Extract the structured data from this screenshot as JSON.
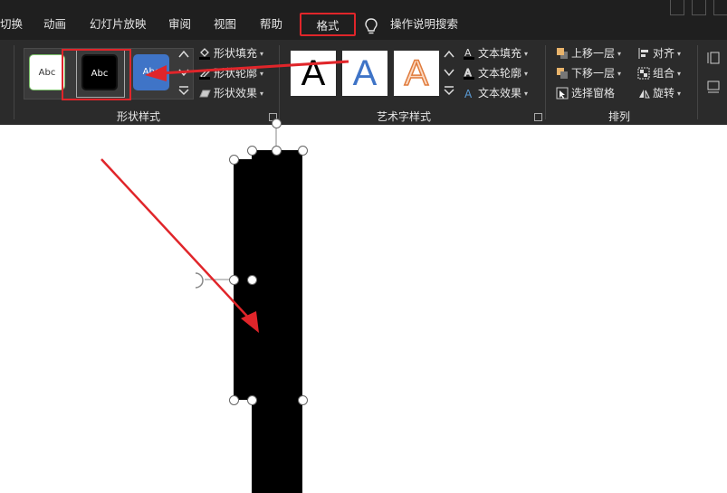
{
  "tabs": [
    {
      "label": "切换"
    },
    {
      "label": "动画"
    },
    {
      "label": "幻灯片放映"
    },
    {
      "label": "审阅"
    },
    {
      "label": "视图"
    },
    {
      "label": "帮助"
    },
    {
      "label": "格式",
      "active": true
    },
    {
      "label": "操作说明搜索"
    }
  ],
  "shape_styles": {
    "group_label": "形状样式",
    "swatches": [
      {
        "label": "Abc",
        "style": "white-green-outline"
      },
      {
        "label": "Abc",
        "style": "black-fill",
        "selected": true
      },
      {
        "label": "Abc",
        "style": "blue-fill"
      }
    ],
    "fill": "形状填充",
    "outline": "形状轮廓",
    "effects": "形状效果"
  },
  "wordart": {
    "group_label": "艺术字样式",
    "samples": [
      "A",
      "A",
      "A"
    ],
    "text_fill": "文本填充",
    "text_outline": "文本轮廓",
    "text_effects": "文本效果"
  },
  "arrange": {
    "group_label": "排列",
    "bring_forward": "上移一层",
    "send_backward": "下移一层",
    "selection_pane": "选择窗格",
    "align": "对齐",
    "group": "组合",
    "rotate": "旋转"
  },
  "colors": {
    "ribbon_bg": "#2b2b2b",
    "tabs_bg": "#1f1f1f",
    "highlight": "#e0252a",
    "shape_fill": "#000000"
  }
}
